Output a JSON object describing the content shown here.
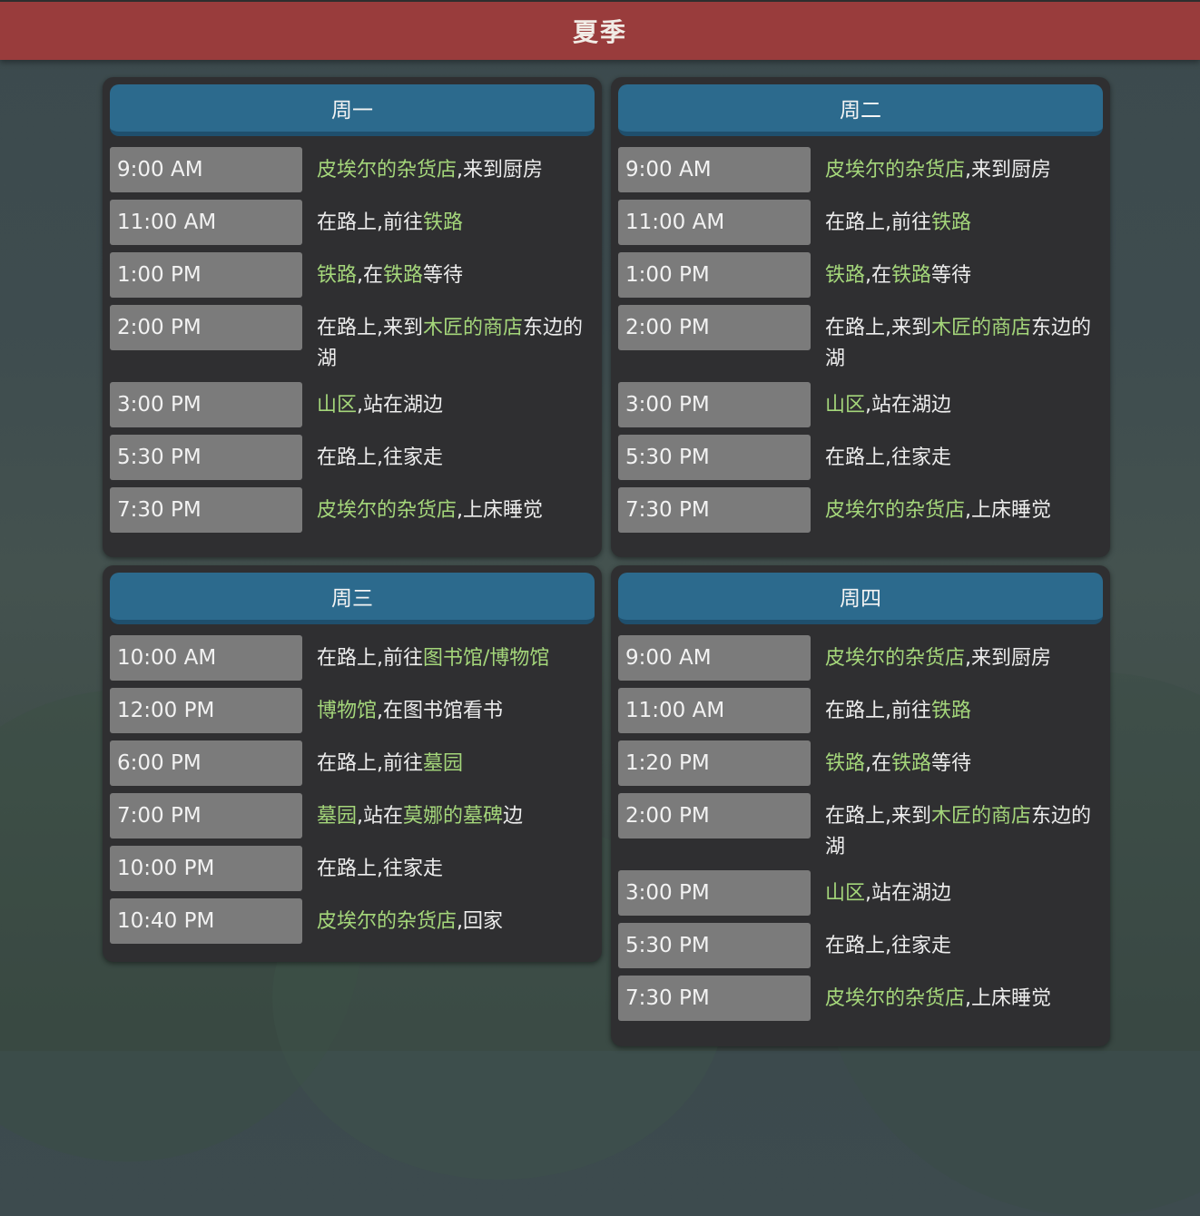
{
  "title": "夏季",
  "days": [
    {
      "name": "周一",
      "rows": [
        {
          "time": "9:00 AM",
          "parts": [
            {
              "text": "皮埃尔的杂货店",
              "hl": true
            },
            {
              "text": ",来到厨房"
            }
          ]
        },
        {
          "time": "11:00 AM",
          "parts": [
            {
              "text": "在路上,前往"
            },
            {
              "text": "铁路",
              "hl": true
            }
          ]
        },
        {
          "time": "1:00 PM",
          "parts": [
            {
              "text": "铁路",
              "hl": true
            },
            {
              "text": ",在"
            },
            {
              "text": "铁路",
              "hl": true
            },
            {
              "text": "等待"
            }
          ]
        },
        {
          "time": "2:00 PM",
          "parts": [
            {
              "text": "在路上,来到"
            },
            {
              "text": "木匠的商店",
              "hl": true
            },
            {
              "text": "东边的湖"
            }
          ]
        },
        {
          "time": "3:00 PM",
          "parts": [
            {
              "text": "山区",
              "hl": true
            },
            {
              "text": ",站在湖边"
            }
          ]
        },
        {
          "time": "5:30 PM",
          "parts": [
            {
              "text": "在路上,往家走"
            }
          ]
        },
        {
          "time": "7:30 PM",
          "parts": [
            {
              "text": "皮埃尔的杂货店",
              "hl": true
            },
            {
              "text": ",上床睡觉"
            }
          ]
        }
      ]
    },
    {
      "name": "周二",
      "rows": [
        {
          "time": "9:00 AM",
          "parts": [
            {
              "text": "皮埃尔的杂货店",
              "hl": true
            },
            {
              "text": ",来到厨房"
            }
          ]
        },
        {
          "time": "11:00 AM",
          "parts": [
            {
              "text": "在路上,前往"
            },
            {
              "text": "铁路",
              "hl": true
            }
          ]
        },
        {
          "time": "1:00 PM",
          "parts": [
            {
              "text": "铁路",
              "hl": true
            },
            {
              "text": ",在"
            },
            {
              "text": "铁路",
              "hl": true
            },
            {
              "text": "等待"
            }
          ]
        },
        {
          "time": "2:00 PM",
          "parts": [
            {
              "text": "在路上,来到"
            },
            {
              "text": "木匠的商店",
              "hl": true
            },
            {
              "text": "东边的湖"
            }
          ]
        },
        {
          "time": "3:00 PM",
          "parts": [
            {
              "text": "山区",
              "hl": true
            },
            {
              "text": ",站在湖边"
            }
          ]
        },
        {
          "time": "5:30 PM",
          "parts": [
            {
              "text": "在路上,往家走"
            }
          ]
        },
        {
          "time": "7:30 PM",
          "parts": [
            {
              "text": "皮埃尔的杂货店",
              "hl": true
            },
            {
              "text": ",上床睡觉"
            }
          ]
        }
      ]
    },
    {
      "name": "周三",
      "rows": [
        {
          "time": "10:00 AM",
          "parts": [
            {
              "text": "在路上,前往"
            },
            {
              "text": "图书馆/博物馆",
              "hl": true
            }
          ]
        },
        {
          "time": "12:00 PM",
          "parts": [
            {
              "text": "博物馆",
              "hl": true
            },
            {
              "text": ",在图书馆看书"
            }
          ]
        },
        {
          "time": "6:00 PM",
          "parts": [
            {
              "text": "在路上,前往"
            },
            {
              "text": "墓园",
              "hl": true
            }
          ]
        },
        {
          "time": "7:00 PM",
          "parts": [
            {
              "text": "墓园",
              "hl": true
            },
            {
              "text": ",站在"
            },
            {
              "text": "莫娜的墓碑",
              "hl": true
            },
            {
              "text": "边"
            }
          ]
        },
        {
          "time": "10:00 PM",
          "parts": [
            {
              "text": "在路上,往家走"
            }
          ]
        },
        {
          "time": "10:40 PM",
          "parts": [
            {
              "text": "皮埃尔的杂货店",
              "hl": true
            },
            {
              "text": ",回家"
            }
          ]
        }
      ]
    },
    {
      "name": "周四",
      "rows": [
        {
          "time": "9:00 AM",
          "parts": [
            {
              "text": "皮埃尔的杂货店",
              "hl": true
            },
            {
              "text": ",来到厨房"
            }
          ]
        },
        {
          "time": "11:00 AM",
          "parts": [
            {
              "text": "在路上,前往"
            },
            {
              "text": "铁路",
              "hl": true
            }
          ]
        },
        {
          "time": "1:20 PM",
          "parts": [
            {
              "text": "铁路",
              "hl": true
            },
            {
              "text": ",在"
            },
            {
              "text": "铁路",
              "hl": true
            },
            {
              "text": "等待"
            }
          ]
        },
        {
          "time": "2:00 PM",
          "parts": [
            {
              "text": "在路上,来到"
            },
            {
              "text": "木匠的商店",
              "hl": true
            },
            {
              "text": "东边的湖"
            }
          ]
        },
        {
          "time": "3:00 PM",
          "parts": [
            {
              "text": "山区",
              "hl": true
            },
            {
              "text": ",站在湖边"
            }
          ]
        },
        {
          "time": "5:30 PM",
          "parts": [
            {
              "text": "在路上,往家走"
            }
          ]
        },
        {
          "time": "7:30 PM",
          "parts": [
            {
              "text": "皮埃尔的杂货店",
              "hl": true
            },
            {
              "text": ",上床睡觉"
            }
          ]
        }
      ]
    }
  ]
}
